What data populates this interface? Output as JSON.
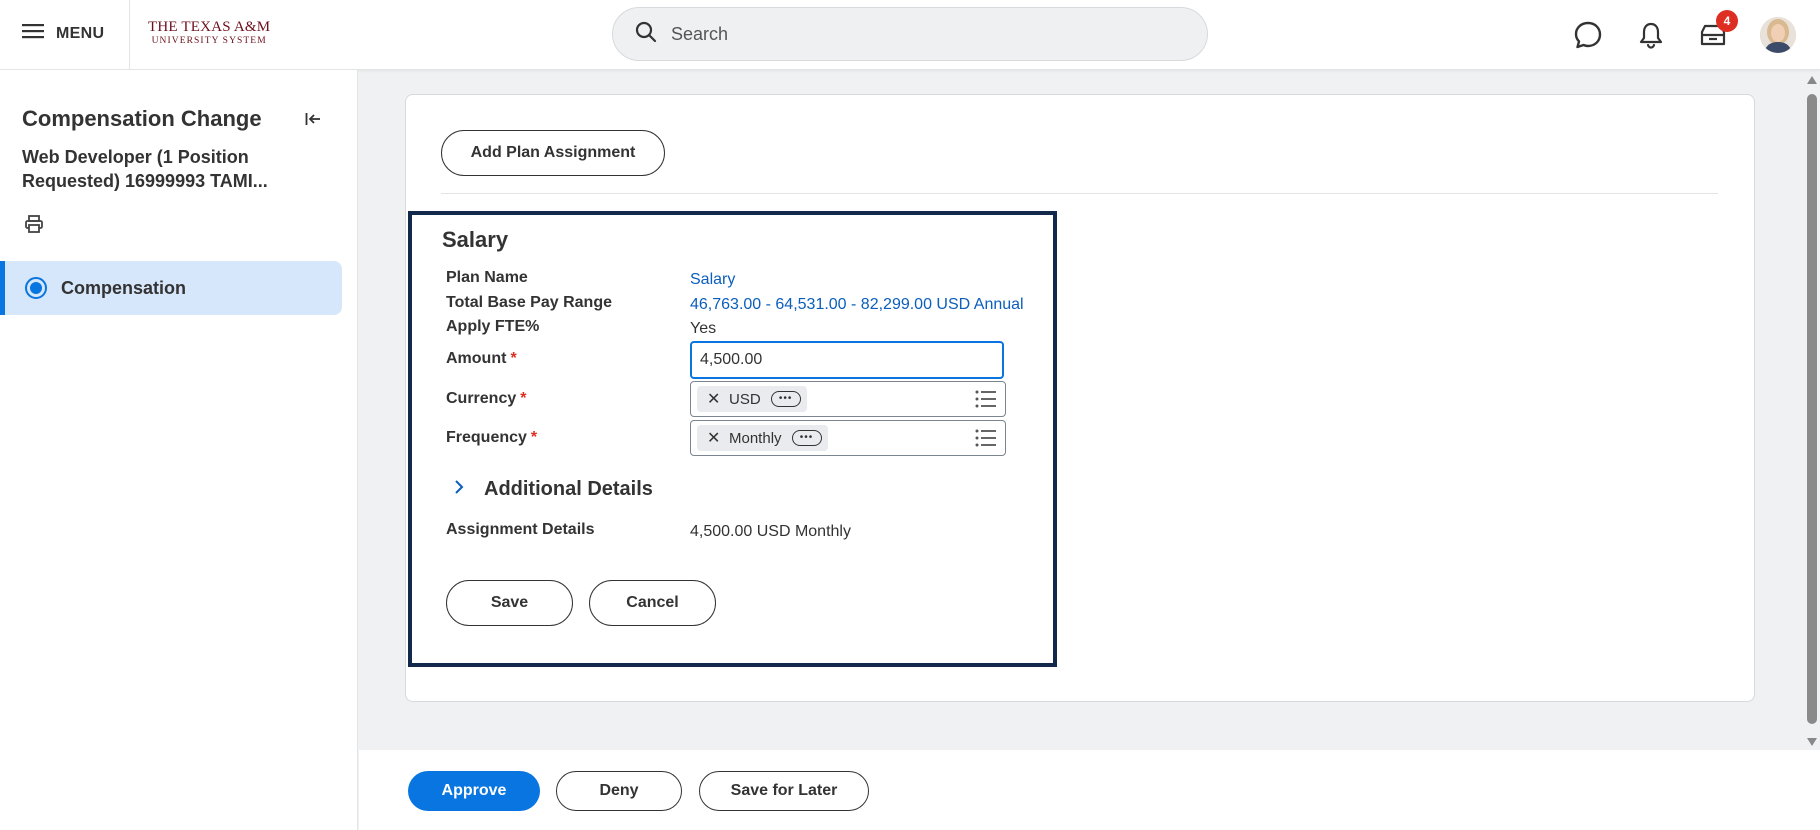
{
  "header": {
    "menu_label": "MENU",
    "logo_line1": "THE TEXAS A&M",
    "logo_line2": "UNIVERSITY SYSTEM",
    "search_placeholder": "Search",
    "inbox_badge": "4"
  },
  "sidebar": {
    "title": "Compensation Change",
    "subtitle": "Web Developer (1 Position Requested) 16999993 TAMI...",
    "items": [
      {
        "label": "Compensation",
        "selected": true
      }
    ]
  },
  "main": {
    "add_plan_label": "Add Plan Assignment",
    "salary": {
      "title": "Salary",
      "fields": {
        "plan_name": {
          "label": "Plan Name",
          "value": "Salary"
        },
        "pay_range": {
          "label": "Total Base Pay Range",
          "value": "46,763.00 - 64,531.00 - 82,299.00 USD Annual"
        },
        "apply_fte": {
          "label": "Apply FTE%",
          "value": "Yes"
        },
        "amount": {
          "label": "Amount",
          "value": "4,500.00"
        },
        "currency": {
          "label": "Currency",
          "value": "USD"
        },
        "frequency": {
          "label": "Frequency",
          "value": "Monthly"
        }
      },
      "additional_details_label": "Additional Details",
      "assignment_details": {
        "label": "Assignment Details",
        "value": "4,500.00 USD Monthly"
      },
      "save_label": "Save",
      "cancel_label": "Cancel",
      "required_marker": "*"
    }
  },
  "footer": {
    "approve_label": "Approve",
    "deny_label": "Deny",
    "save_later_label": "Save for Later"
  },
  "colors": {
    "accent": "#0875e1",
    "link": "#0b5ebc",
    "required": "#de2e21",
    "brand_maroon": "#6b0f1a",
    "highlight_border": "#13294b",
    "selected_bg": "#d7e7fb"
  },
  "icons": [
    "hamburger-icon",
    "search-icon",
    "chat-icon",
    "bell-icon",
    "inbox-icon",
    "collapse-icon",
    "print-icon",
    "chevron-right-icon",
    "close-icon",
    "more-icon",
    "list-icon"
  ]
}
